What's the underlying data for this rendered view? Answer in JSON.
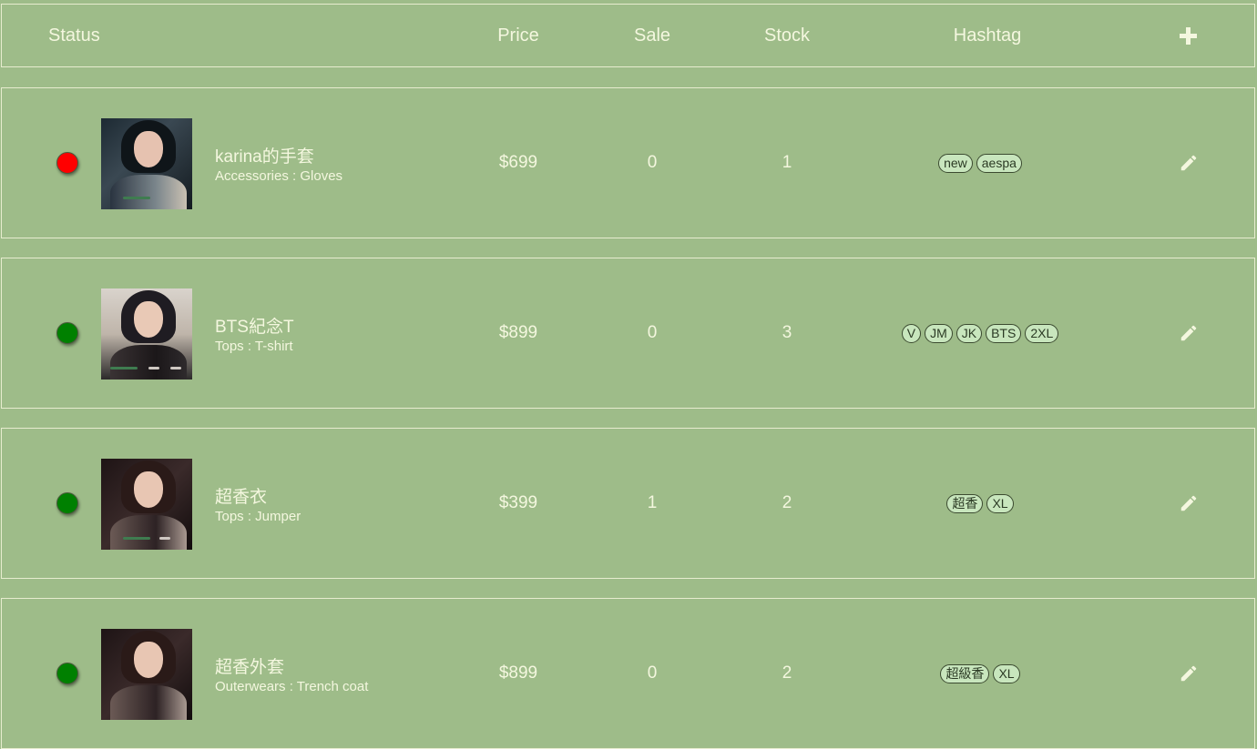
{
  "header": {
    "status": "Status",
    "price": "Price",
    "sale": "Sale",
    "stock": "Stock",
    "hashtag": "Hashtag",
    "add_icon": "plus-icon"
  },
  "rows": [
    {
      "status_color": "#ff0000",
      "name": "karina的手套",
      "category": "Accessories : Gloves",
      "price": "$699",
      "sale": "0",
      "stock": "1",
      "tags": [
        "new",
        "aespa"
      ]
    },
    {
      "status_color": "#008000",
      "name": "BTS紀念T",
      "category": "Tops : T-shirt",
      "price": "$899",
      "sale": "0",
      "stock": "3",
      "tags": [
        "V",
        "JM",
        "JK",
        "BTS",
        "2XL"
      ]
    },
    {
      "status_color": "#008000",
      "name": "超香衣",
      "category": "Tops : Jumper",
      "price": "$399",
      "sale": "1",
      "stock": "2",
      "tags": [
        "超香",
        "XL"
      ]
    },
    {
      "status_color": "#008000",
      "name": "超香外套",
      "category": "Outerwears : Trench coat",
      "price": "$899",
      "sale": "0",
      "stock": "2",
      "tags": [
        "超級香",
        "XL"
      ]
    }
  ],
  "colors": {
    "background": "#9ebc89",
    "text": "#f4f7df",
    "tag_bg": "#c8e6bd",
    "tag_text": "#2b3a24"
  },
  "icons": {
    "edit": "pencil-icon"
  }
}
